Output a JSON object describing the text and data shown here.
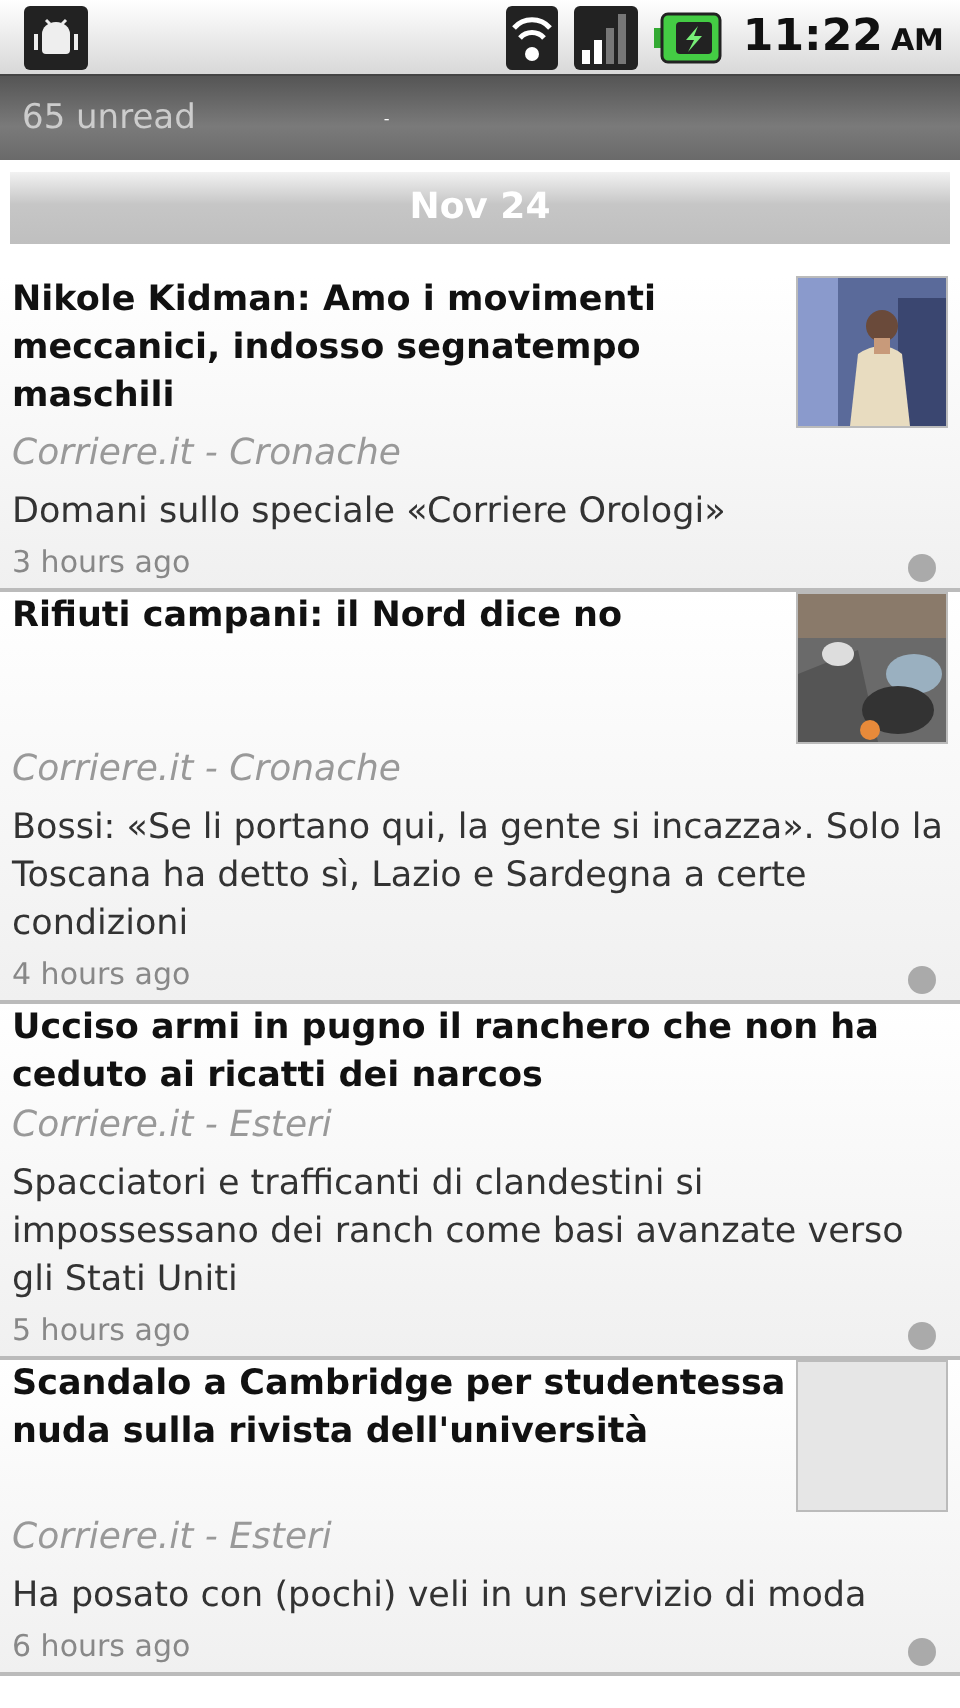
{
  "status_bar": {
    "time": "11:22",
    "ampm": "AM"
  },
  "header": {
    "unread": "65 unread",
    "separator": "-"
  },
  "date_header": "Nov 24",
  "articles": [
    {
      "title": "Nikole Kidman:  Amo i movimenti meccanici, indosso segnatempo maschili",
      "source": "Corriere.it - Cronache",
      "summary": "Domani sullo speciale «Corriere Orologi»",
      "time": "3 hours ago"
    },
    {
      "title": "Rifiuti campani: il Nord dice no",
      "source": "Corriere.it - Cronache",
      "summary": "Bossi: «Se li portano qui, la gente si incazza». Solo la Toscana ha detto sì, Lazio e Sardegna a certe condizioni",
      "time": "4 hours ago"
    },
    {
      "title": "Ucciso armi in pugno il ranchero  che non ha ceduto ai ricatti dei narcos",
      "source": "Corriere.it - Esteri",
      "summary": "Spacciatori e trafficanti di clandestini si impossessano dei ranch come basi avanzate verso gli Stati Uniti",
      "time": "5 hours ago"
    },
    {
      "title": "Scandalo a Cambridge per studentessa nuda sulla rivista dell'università",
      "source": "Corriere.it - Esteri",
      "summary": "Ha posato con (pochi) veli in un servizio di moda",
      "time": "6 hours ago",
      "thumbnail": {
        "kind": "placeholder"
      }
    }
  ]
}
